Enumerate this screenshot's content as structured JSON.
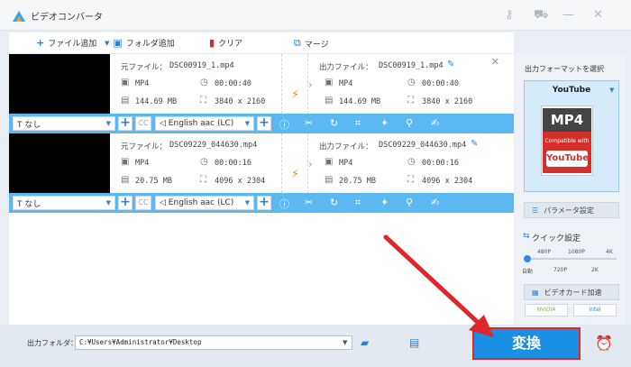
{
  "app": {
    "title": "ビデオコンバータ"
  },
  "toolbar": {
    "add_file": "ファイル追加",
    "add_folder": "フォルダ追加",
    "clear": "クリア",
    "merge": "マージ"
  },
  "files": [
    {
      "source_label": "元ファイル：",
      "source_name": "DSC00919_1.mp4",
      "format": "MP4",
      "duration": "00:00:40",
      "size": "144.69 MB",
      "resolution": "3840 x 2160",
      "output_label": "出力ファイル：",
      "output_name": "DSC00919_1.mp4",
      "out_format": "MP4",
      "out_duration": "00:00:40",
      "out_size": "144.69 MB",
      "out_resolution": "3840 x 2160",
      "subtitle": "なし",
      "audio": "English aac (LC)"
    },
    {
      "source_label": "元ファイル：",
      "source_name": "DSC09229_044630.mp4",
      "format": "MP4",
      "duration": "00:00:16",
      "size": "20.75 MB",
      "resolution": "4096 x 2304",
      "output_label": "出力ファイル：",
      "output_name": "DSC09229_044630.mp4",
      "out_format": "MP4",
      "out_duration": "00:00:16",
      "out_size": "20.75 MB",
      "out_resolution": "4096 x 2304",
      "subtitle": "なし",
      "audio": "English aac (LC)"
    }
  ],
  "sidebar": {
    "title": "出力フォーマットを選択",
    "format_name": "YouTube",
    "format_badge": "MP4",
    "format_compat": "Compatible with",
    "format_logo": "YouTube",
    "params_button": "パラメータ設定",
    "quick_label": "クイック設定",
    "res_top": [
      "480P",
      "1080P",
      "4K"
    ],
    "res_bottom": [
      "自動",
      "720P",
      "2K"
    ],
    "gpu_button": "ビデオカード加速",
    "gpu_nvidia": "NVIDIA",
    "gpu_intel": "intel"
  },
  "bottom": {
    "output_folder_label": "出力フォルダ：",
    "output_path": "C:¥Users¥Administrator¥Desktop",
    "convert_label": "変換"
  },
  "colors": {
    "accent": "#1a8fe3",
    "bar": "#5cb8f0",
    "highlight": "#e0262a"
  }
}
